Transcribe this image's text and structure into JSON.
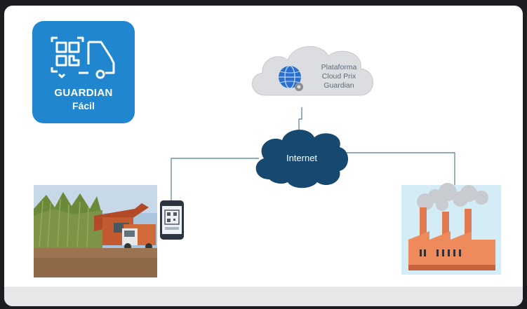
{
  "logo": {
    "title": "GUARDIAN",
    "subtitle": "Fácil",
    "icon": "qr-truck-icon",
    "color": "#1f86cf"
  },
  "diagram": {
    "cloud_platform": {
      "lines": [
        "Plataforma",
        "Cloud Prix",
        "Guardian"
      ],
      "icon": "globe-gear-icon"
    },
    "internet_label": "Internet",
    "left_node": {
      "icon": "sugarcane-harvest-photo",
      "device_icon": "smartphone-qr-icon"
    },
    "right_node": {
      "icon": "factory-icon"
    },
    "colors": {
      "cloud_platform": "#dcdde0",
      "internet_cloud": "#17486f",
      "connector": "#6b8fa6"
    }
  }
}
